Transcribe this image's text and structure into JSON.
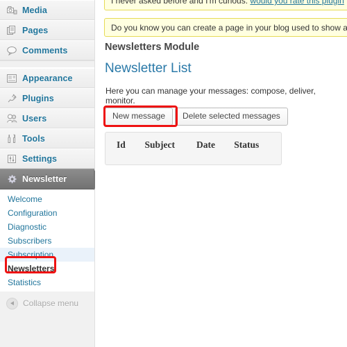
{
  "sidebar": {
    "top_items": [
      {
        "label": "Media",
        "icon": "media-icon"
      },
      {
        "label": "Pages",
        "icon": "pages-icon"
      },
      {
        "label": "Comments",
        "icon": "comments-icon"
      },
      {
        "label": "Appearance",
        "icon": "appearance-icon"
      },
      {
        "label": "Plugins",
        "icon": "plugins-icon"
      },
      {
        "label": "Users",
        "icon": "users-icon"
      },
      {
        "label": "Tools",
        "icon": "tools-icon"
      },
      {
        "label": "Settings",
        "icon": "settings-icon"
      }
    ],
    "active_item": {
      "label": "Newsletter",
      "icon": "gear-icon"
    },
    "submenu": [
      {
        "label": "Welcome",
        "state": "normal"
      },
      {
        "label": "Configuration",
        "state": "normal"
      },
      {
        "label": "Diagnostic",
        "state": "normal"
      },
      {
        "label": "Subscribers",
        "state": "normal"
      },
      {
        "label": "Subscription",
        "state": "hover"
      },
      {
        "label": "Newsletters",
        "state": "current"
      },
      {
        "label": "Statistics",
        "state": "normal"
      }
    ],
    "collapse": {
      "label": "Collapse menu",
      "icon": "collapse-left-icon"
    }
  },
  "notices": {
    "rate": {
      "text_before": "I never asked before and I'm curious: ",
      "link": "would you rate this plugin",
      "text_after": " ? ("
    },
    "page": {
      "text": "Do you know you can create a page in your blog used to show all N"
    }
  },
  "main": {
    "module_title": "Newsletters Module",
    "page_title": "Newsletter List",
    "description": "Here you can manage your messages: compose, deliver, monitor.",
    "buttons": {
      "new_message": "New message",
      "delete_selected": "Delete selected messages"
    },
    "table": {
      "headers": [
        "Id",
        "Subject",
        "Date",
        "Status"
      ],
      "rows": []
    }
  },
  "colors": {
    "accent_blue": "#21759b",
    "title_blue": "#2a79a8",
    "notice_bg": "#ffffe0",
    "notice_border": "#e6db55",
    "annotation_red": "#ee1111",
    "sidebar_bg": "#f1f1f1",
    "active_menu_bg": "#777777",
    "submenu_hover_bg": "#eaf2fa"
  }
}
